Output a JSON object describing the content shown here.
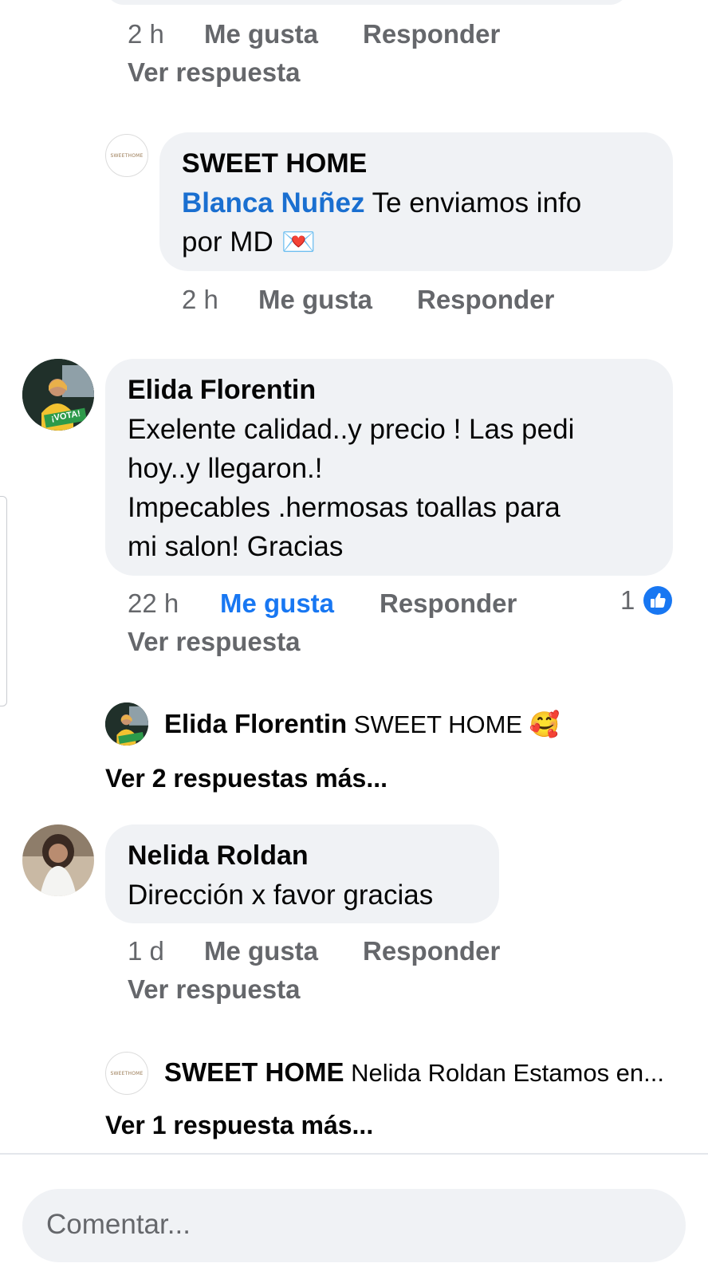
{
  "top_bubble": {},
  "first_actions": {
    "time": "2 h",
    "like": "Me gusta",
    "reply": "Responder",
    "view_reply": "Ver respuesta"
  },
  "sweet_reply": {
    "author": "SWEET HOME",
    "logo_text": "SWEETHOME",
    "mention": "Blanca Nuñez",
    "text_line1_rest": " Te enviamos info",
    "text_line2": "por MD",
    "emoji": "💌",
    "time": "2 h",
    "like": "Me gusta",
    "reply": "Responder"
  },
  "elida_comment": {
    "author": "Elida Florentin",
    "lines": [
      "Exelente calidad..y precio !  Las pedi",
      "hoy..y llegaron.!",
      "Impecables  .hermosas toallas para",
      "mi salon! Gracias"
    ],
    "time": "22 h",
    "like": "Me gusta",
    "reply": "Responder",
    "reaction_count": "1",
    "view_reply": "Ver respuesta",
    "avatar_badge": "¡VOTA!"
  },
  "elida_reply_preview": {
    "author": "Elida Florentin",
    "text": " SWEET HOME ",
    "emoji": "🥰",
    "more": "Ver 2 respuestas más..."
  },
  "nelida_comment": {
    "author": "Nelida Roldan",
    "text": "Dirección x favor gracias",
    "time": "1 d",
    "like": "Me gusta",
    "reply": "Responder",
    "view_reply": "Ver respuesta"
  },
  "sweet_reply_preview": {
    "author": "SWEET HOME",
    "logo_text": "SWEETHOME",
    "text": " Nelida Roldan Estamos en...",
    "more": "Ver 1 respuesta más..."
  },
  "composer": {
    "placeholder": "Comentar..."
  },
  "colors": {
    "bubble": "#f0f2f5",
    "link_blue": "#1877f2",
    "meta_gray": "#65676b"
  }
}
